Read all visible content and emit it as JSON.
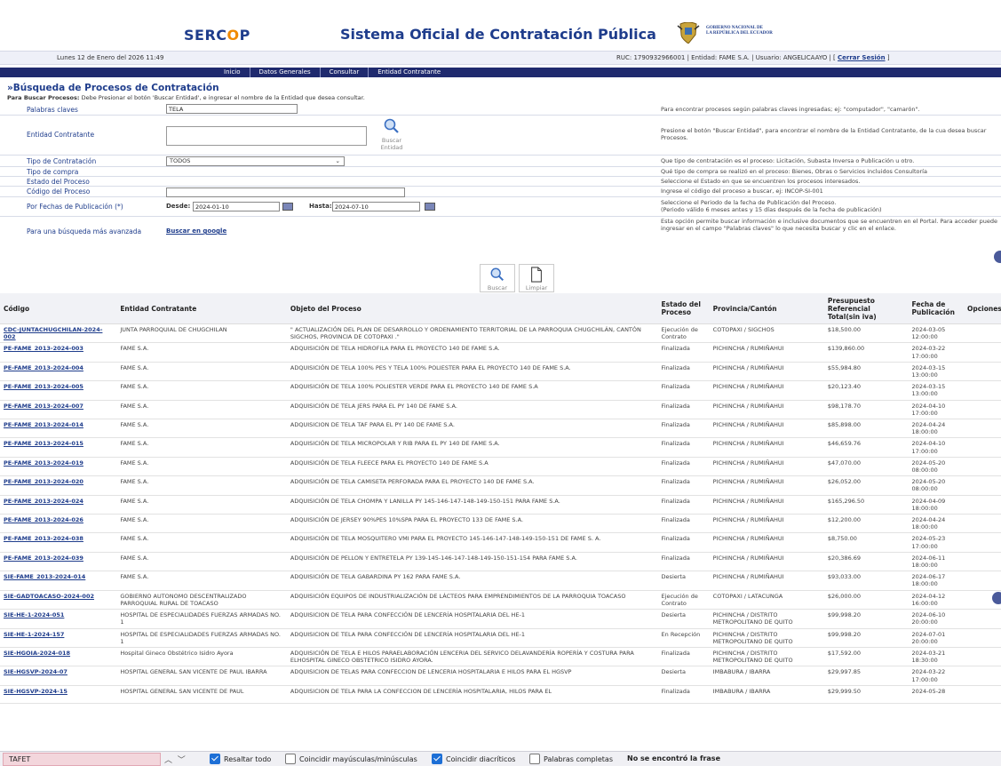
{
  "header": {
    "logo_a": "SERC",
    "logo_o": "O",
    "logo_b": "P",
    "system_title": "Sistema Oficial de Contratación Pública",
    "gov_line1": "GOBIERNO NACIONAL DE",
    "gov_line2": "LA REPÚBLICA DEL ECUADOR"
  },
  "infobar": {
    "date": "Lunes 12 de Enero del 2026 11:49",
    "ruc_text": "RUC: 1790932966001 | Entidad: FAME S.A. | Usuario: ANGELICAAYO | [",
    "logout": "Cerrar Sesión",
    "close_bracket": "]"
  },
  "nav": [
    "Inicio",
    "Datos Generales",
    "Consultar",
    "Entidad Contratante"
  ],
  "page": {
    "title": "»Búsqueda de Procesos de Contratación",
    "instr_bold": "Para Buscar Procesos:",
    "instr_text": " Debe Presionar el botón 'Buscar Entidad', e ingresar el nombre de la Entidad que desea consultar."
  },
  "form": {
    "keywords_label": "Palabras claves",
    "keywords_value": "TELA",
    "keywords_help": "Para encontrar procesos según palabras claves ingresadas; ej: \"computador\", \"camarón\".",
    "entity_label": "Entidad Contratante",
    "entity_search_line1": "Buscar",
    "entity_search_line2": "Entidad",
    "entity_help": "Presione el botón \"Buscar Entidad\", para encontrar el nombre de la Entidad Contratante, de la cua desea buscar Procesos.",
    "type_label": "Tipo de Contratación",
    "type_value": "TODOS",
    "type_help": "Que tipo de contratación es el proceso: Licitación, Subasta Inversa o Publicación u otro.",
    "purchase_label": "Tipo de compra",
    "purchase_help": "Qué tipo de compra se realizó en el proceso: Bienes, Obras o Servicios incluidos Consultoría",
    "state_label": "Estado del Proceso",
    "state_help": "Seleccione el Estado en que se encuentren los procesos interesados.",
    "code_label": "Código del Proceso",
    "code_help": "Ingrese el código del proceso a buscar, ej: INCOP-SI-001",
    "dates_label": "Por Fechas de Publicación (*)",
    "from_label": "Desde:",
    "from_value": "2024-01-10",
    "to_label": "Hasta:",
    "to_value": "2024-07-10",
    "dates_help_1": "Seleccione el Periodo de la fecha de Publicación del Proceso.",
    "dates_help_2": "(Periodo válido 6 meses antes y 15 días después de la fecha de publicación)",
    "advanced_label": "Para una búsqueda más avanzada",
    "advanced_link": "Buscar en google",
    "advanced_help": "Esta opción permite buscar información e inclusive documentos que se encuentren en el Portal. Para acceder puede ingresar en el campo \"Palabras claves\" lo que necesita buscar y clic en el enlace."
  },
  "actions": {
    "search": "Buscar",
    "clear": "Limpiar"
  },
  "table": {
    "headers": [
      "Código",
      "Entidad Contratante",
      "Objeto del Proceso",
      "Estado del Proceso",
      "Provincia/Cantón",
      "Presupuesto Referencial Total(sin iva)",
      "Fecha de Publicación",
      "Opciones"
    ],
    "rows": [
      {
        "code": "CDC-JUNTACHUGCHILAN-2024-002",
        "entity": "JUNTA PARROQUIAL DE CHUGCHILAN",
        "object": "\" ACTUALIZACIÓN DEL PLAN DE DESARROLLO Y ORDENAMIENTO TERRITORIAL DE LA PARROQUIA CHUGCHILÁN, CANTÓN SIGCHOS, PROVINCIA DE COTOPAXI .\"",
        "state": "Ejecución de Contrato",
        "prov": "COTOPAXI / SIGCHOS",
        "budget": "$18,500.00",
        "date": "2024-03-05 12:00:00"
      },
      {
        "code": "PE-FAME_2013-2024-003",
        "entity": "FAME S.A.",
        "object": "ADQUISICIÓN DE TELA HIDROFILA PARA EL PROYECTO 140 DE FAME S.A.",
        "state": "Finalizada",
        "prov": "PICHINCHA / RUMIÑAHUI",
        "budget": "$139,860.00",
        "date": "2024-03-22 17:00:00"
      },
      {
        "code": "PE-FAME_2013-2024-004",
        "entity": "FAME S.A.",
        "object": "ADQUISICIÓN DE TELA 100% PES Y TELA 100% POLIESTER PARA EL PROYECTO 140 DE FAME S.A.",
        "state": "Finalizada",
        "prov": "PICHINCHA / RUMIÑAHUI",
        "budget": "$55,984.80",
        "date": "2024-03-15 13:00:00"
      },
      {
        "code": "PE-FAME_2013-2024-005",
        "entity": "FAME S.A.",
        "object": "ADQUISICIÓN DE TELA 100% POLIESTER VERDE PARA EL PROYECTO 140 DE FAME S.A",
        "state": "Finalizada",
        "prov": "PICHINCHA / RUMIÑAHUI",
        "budget": "$20,123.40",
        "date": "2024-03-15 13:00:00"
      },
      {
        "code": "PE-FAME_2013-2024-007",
        "entity": "FAME S.A.",
        "object": "ADQUISICIÓN DE TELA JERS PARA EL PY 140 DE FAME S.A.",
        "state": "Finalizada",
        "prov": "PICHINCHA / RUMIÑAHUI",
        "budget": "$98,178.70",
        "date": "2024-04-10 17:00:00"
      },
      {
        "code": "PE-FAME_2013-2024-014",
        "entity": "FAME S.A.",
        "object": "ADQUISICION DE TELA TAF PARA EL PY 140 DE FAME S.A.",
        "state": "Finalizada",
        "prov": "PICHINCHA / RUMIÑAHUI",
        "budget": "$85,898.00",
        "date": "2024-04-24 18:00:00"
      },
      {
        "code": "PE-FAME_2013-2024-015",
        "entity": "FAME S.A.",
        "object": "ADQUISICIÓN DE TELA MICROPOLAR Y RIB PARA EL PY 140 DE FAME S.A.",
        "state": "Finalizada",
        "prov": "PICHINCHA / RUMIÑAHUI",
        "budget": "$46,659.76",
        "date": "2024-04-10 17:00:00"
      },
      {
        "code": "PE-FAME_2013-2024-019",
        "entity": "FAME S.A.",
        "object": "ADQUISICIÓN DE TELA FLEECE PARA EL PROYECTO 140 DE FAME S.A",
        "state": "Finalizada",
        "prov": "PICHINCHA / RUMIÑAHUI",
        "budget": "$47,070.00",
        "date": "2024-05-20 08:00:00"
      },
      {
        "code": "PE-FAME_2013-2024-020",
        "entity": "FAME S.A.",
        "object": "ADQUISICIÓN DE TELA CAMISETA PERFORADA PARA EL PROYECTO 140 DE FAME S.A.",
        "state": "Finalizada",
        "prov": "PICHINCHA / RUMIÑAHUI",
        "budget": "$26,052.00",
        "date": "2024-05-20 08:00:00"
      },
      {
        "code": "PE-FAME_2013-2024-024",
        "entity": "FAME S.A.",
        "object": "ADQUISICIÓN DE TELA CHOMPA Y LANILLA PY 145-146-147-148-149-150-151 PARA FAME S.A.",
        "state": "Finalizada",
        "prov": "PICHINCHA / RUMIÑAHUI",
        "budget": "$165,296.50",
        "date": "2024-04-09 18:00:00"
      },
      {
        "code": "PE-FAME_2013-2024-026",
        "entity": "FAME S.A.",
        "object": "ADQUISICIÓN DE JERSEY 90%PES 10%SPA PARA EL PROYECTO 133 DE FAME S.A.",
        "state": "Finalizada",
        "prov": "PICHINCHA / RUMIÑAHUI",
        "budget": "$12,200.00",
        "date": "2024-04-24 18:00:00"
      },
      {
        "code": "PE-FAME_2013-2024-038",
        "entity": "FAME S.A.",
        "object": "ADQUISICIÓN DE TELA MOSQUITERO VMI PARA EL PROYECTO 145-146-147-148-149-150-151 DE FAME S. A.",
        "state": "Finalizada",
        "prov": "PICHINCHA / RUMIÑAHUI",
        "budget": "$8,750.00",
        "date": "2024-05-23 17:00:00"
      },
      {
        "code": "PE-FAME_2013-2024-039",
        "entity": "FAME S.A.",
        "object": "ADQUISICIÓN DE PELLON Y ENTRETELA PY 139-145-146-147-148-149-150-151-154 PARA FAME S.A.",
        "state": "Finalizada",
        "prov": "PICHINCHA / RUMIÑAHUI",
        "budget": "$20,386.69",
        "date": "2024-06-11 18:00:00"
      },
      {
        "code": "SIE-FAME_2013-2024-014",
        "entity": "FAME S.A.",
        "object": "ADQUISICIÓN DE TELA GABARDINA PY 162 PARA FAME S.A.",
        "state": "Desierta",
        "prov": "PICHINCHA / RUMIÑAHUI",
        "budget": "$93,033.00",
        "date": "2024-06-17 18:00:00"
      },
      {
        "code": "SIE-GADTOACASO-2024-002",
        "entity": "GOBIERNO AUTONOMO DESCENTRALIZADO PARROQUIAL RURAL DE TOACASO",
        "object": "ADQUISICIÓN EQUIPOS DE INDUSTRIALIZACIÓN DE LÁCTEOS PARA EMPRENDIMIENTOS DE LA PARROQUIA TOACASO",
        "state": "Ejecución de Contrato",
        "prov": "COTOPAXI / LATACUNGA",
        "budget": "$26,000.00",
        "date": "2024-04-12 16:00:00"
      },
      {
        "code": "SIE-HE-1-2024-051",
        "entity": "HOSPITAL DE ESPECIALIDADES FUERZAS ARMADAS NO. 1",
        "object": "ADQUISICION DE TELA PARA CONFECCIÓN DE LENCERÍA HOSPITALARIA DEL HE-1",
        "state": "Desierta",
        "prov": "PICHINCHA / DISTRITO METROPOLITANO DE QUITO",
        "budget": "$99,998.20",
        "date": "2024-06-10 20:00:00"
      },
      {
        "code": "SIE-HE-1-2024-157",
        "entity": "HOSPITAL DE ESPECIALIDADES FUERZAS ARMADAS NO. 1",
        "object": "ADQUISICION DE TELA PARA CONFECCIÓN DE LENCERÍA HOSPITALARIA DEL HE-1",
        "state": "En Recepción",
        "prov": "PICHINCHA / DISTRITO METROPOLITANO DE QUITO",
        "budget": "$99,998.20",
        "date": "2024-07-01 20:00:00"
      },
      {
        "code": "SIE-HGOIA-2024-018",
        "entity": "Hospital Gineco Obstétrico Isidro Ayora",
        "object": "ADQUISICIÓN DE TELA E HILOS PARAELABORACIÓN LENCERIA DEL SERVICO DELAVANDERÍA ROPERÍA Y COSTURA PARA ELHOSPITAL GINECO OBSTETRICO ISIDRO AYORA.",
        "state": "Finalizada",
        "prov": "PICHINCHA / DISTRITO METROPOLITANO DE QUITO",
        "budget": "$17,592.00",
        "date": "2024-03-21 18:30:00"
      },
      {
        "code": "SIE-HGSVP-2024-07",
        "entity": "HOSPITAL GENERAL SAN VICENTE DE PAUL IBARRA",
        "object": "ADQUISICION DE TELAS PARA CONFECCION DE LENCERIA HOSPITALARIA E HILOS PARA EL HGSVP",
        "state": "Desierta",
        "prov": "IMBABURA / IBARRA",
        "budget": "$29,997.85",
        "date": "2024-03-22 17:00:00"
      },
      {
        "code": "SIE-HGSVP-2024-15",
        "entity": "HOSPITAL GENERAL SAN VICENTE DE PAUL",
        "object": "ADQUISICION DE TELA PARA LA CONFECCION DE LENCERÍA HOSPITALARIA, HILOS PARA EL",
        "state": "Finalizada",
        "prov": "IMBABURA / IBARRA",
        "budget": "$29,999.50",
        "date": "2024-05-28"
      }
    ]
  },
  "findbar": {
    "query": "TAFET",
    "highlight_all": "Resaltar todo",
    "match_case": "Coincidir mayúsculas/minúsculas",
    "match_diacritics": "Coincidir diacríticos",
    "whole_words": "Palabras completas",
    "message": "No se encontró la frase"
  }
}
